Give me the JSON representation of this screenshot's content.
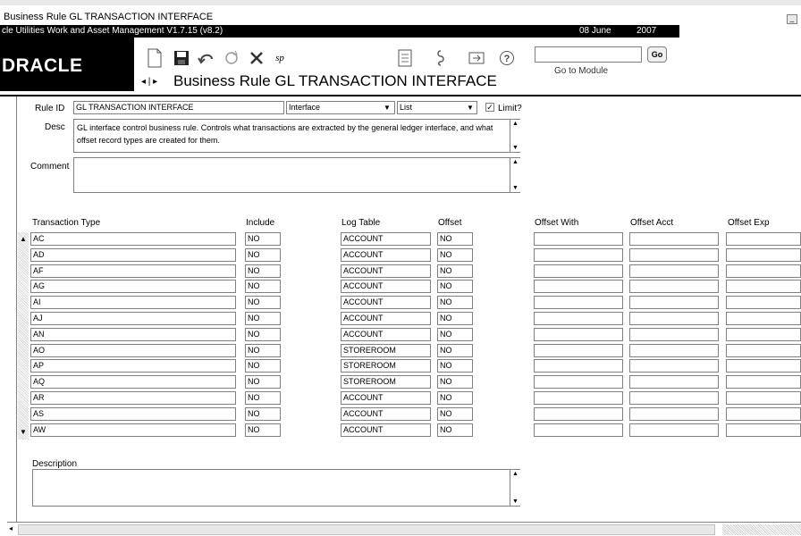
{
  "window": {
    "title": "Business Rule GL TRANSACTION INTERFACE",
    "app_name": "cle Utilities Work and Asset Management V1.7.15 (v8.2)",
    "date": "08 June",
    "year": "2007",
    "minimize_label": "_"
  },
  "logo": {
    "text": "DRACLE"
  },
  "toolbar": {
    "nav_arrows": "◂ | ▸",
    "page_title": "Business Rule GL TRANSACTION INTERFACE",
    "go_to_module_label": "Go to Module",
    "go_button": "Go",
    "go_input_value": "",
    "sp_label": "sp"
  },
  "form": {
    "rule_id_label": "Rule ID",
    "rule_id_value": "GL TRANSACTION INTERFACE",
    "category_value": "Interface",
    "type_value": "List",
    "limit_label": "Limit?",
    "limit_checked": true,
    "desc_label": "Desc",
    "desc_value": "GL interface control business rule.  Controls what transactions are extracted by the general ledger interface, and what offset record types are created for them.",
    "comment_label": "Comment",
    "comment_value": "",
    "description_label": "Description",
    "description_value": ""
  },
  "grid": {
    "headers": {
      "transaction_type": "Transaction Type",
      "include": "Include",
      "log_table": "Log Table",
      "offset": "Offset",
      "offset_with": "Offset With",
      "offset_acct": "Offset Acct",
      "offset_exp": "Offset Exp"
    },
    "rows": [
      {
        "type": "AC",
        "include": "NO",
        "log_table": "ACCOUNT",
        "offset": "NO"
      },
      {
        "type": "AD",
        "include": "NO",
        "log_table": "ACCOUNT",
        "offset": "NO"
      },
      {
        "type": "AF",
        "include": "NO",
        "log_table": "ACCOUNT",
        "offset": "NO"
      },
      {
        "type": "AG",
        "include": "NO",
        "log_table": "ACCOUNT",
        "offset": "NO"
      },
      {
        "type": "AI",
        "include": "NO",
        "log_table": "ACCOUNT",
        "offset": "NO"
      },
      {
        "type": "AJ",
        "include": "NO",
        "log_table": "ACCOUNT",
        "offset": "NO"
      },
      {
        "type": "AN",
        "include": "NO",
        "log_table": "ACCOUNT",
        "offset": "NO"
      },
      {
        "type": "AO",
        "include": "NO",
        "log_table": "STOREROOM",
        "offset": "NO"
      },
      {
        "type": "AP",
        "include": "NO",
        "log_table": "STOREROOM",
        "offset": "NO"
      },
      {
        "type": "AQ",
        "include": "NO",
        "log_table": "STOREROOM",
        "offset": "NO"
      },
      {
        "type": "AR",
        "include": "NO",
        "log_table": "ACCOUNT",
        "offset": "NO"
      },
      {
        "type": "AS",
        "include": "NO",
        "log_table": "ACCOUNT",
        "offset": "NO"
      },
      {
        "type": "AW",
        "include": "NO",
        "log_table": "ACCOUNT",
        "offset": "NO"
      }
    ]
  }
}
